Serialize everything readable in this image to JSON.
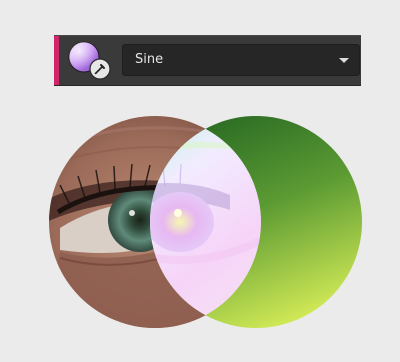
{
  "blend_node": {
    "icon": "blend-material-node-icon",
    "sub_icon": "eyedropper-icon",
    "accent_color": "#d0266a"
  },
  "blend_mode": {
    "selected": "Sine",
    "caret_icon": "chevron-down-icon"
  },
  "preview": {
    "base_layer": "eye-photo",
    "overlay_layer": "green-gradient",
    "overlay_colors": [
      "#2a6b24",
      "#d8ee58"
    ],
    "result_region": "blended-intersection"
  }
}
